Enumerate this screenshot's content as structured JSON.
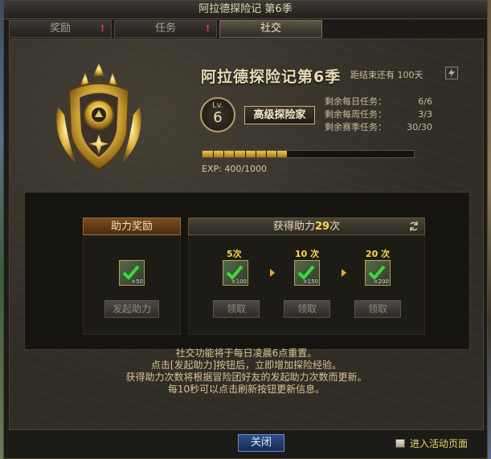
{
  "window": {
    "title": "阿拉德探险记 第6季"
  },
  "tabs": [
    {
      "label": "奖励",
      "alert": "!"
    },
    {
      "label": "任务",
      "alert": "!"
    },
    {
      "label": "社交"
    }
  ],
  "season": {
    "title": "阿拉德探险记第6季",
    "remaining": "距结束还有 100天",
    "level_prefix": "Lv.",
    "level": "6",
    "rank": "高级探险家",
    "stats": [
      {
        "label": "剩余每日任务：",
        "value": "6/6"
      },
      {
        "label": "剩余每周任务：",
        "value": "3/3"
      },
      {
        "label": "剩余赛季任务：",
        "value": "30/30"
      }
    ],
    "exp_text": "EXP:  400/1000",
    "exp_fraction": 0.4
  },
  "assist_reward": {
    "header": "助力奖励",
    "item_qty": "×50",
    "button": "发起助力"
  },
  "gained": {
    "header_prefix": "获得助力",
    "count": "29",
    "header_suffix": "次",
    "tiers": [
      {
        "count": "5次",
        "qty": "×100",
        "button": "领取"
      },
      {
        "count": "10 次",
        "qty": "×150",
        "button": "领取"
      },
      {
        "count": "20 次",
        "qty": "×200",
        "button": "领取"
      }
    ]
  },
  "info_lines": [
    "社交功能将于每日凌晨6点重置。",
    "点击[发起助力]按钮后，立即增加探险经验。",
    "获得助力次数将根据冒险团好友的发起助力次数而更新。",
    "每10秒可以点击刷新按钮更新信息。"
  ],
  "footer": {
    "close": "关闭",
    "goto": "进入活动页面"
  },
  "colors": {
    "accent_gold": "#ffd84a",
    "exp_fill": "#f2c64a",
    "close_blue": "#2f4f8a"
  }
}
